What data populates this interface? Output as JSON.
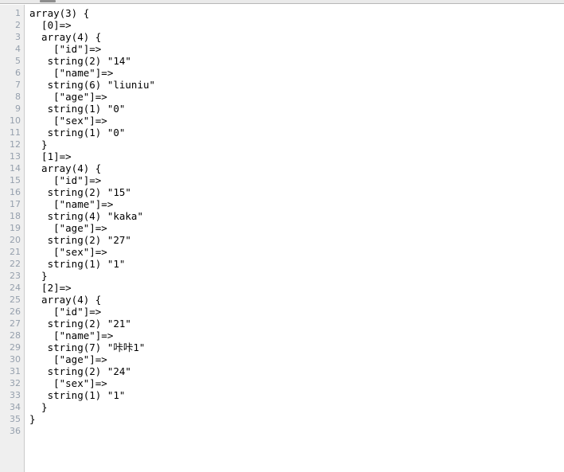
{
  "window": {
    "title": "var_dump output",
    "scrollbar": {
      "orientation": "horizontal",
      "thumb_label": "horizontal-scroll-thumb"
    }
  },
  "colors": {
    "background": "#ffffff",
    "gutter_background": "#efefef",
    "gutter_border": "#c9c9c9",
    "line_number_text": "#96a0ad",
    "code_text": "#000000",
    "chrome_strip": "#eaeaea",
    "chrome_border": "#b8b8b8",
    "scroll_thumb": "#8d8d8d"
  },
  "editor": {
    "total_lines": 36,
    "line_numbers": [
      1,
      2,
      3,
      4,
      5,
      6,
      7,
      8,
      9,
      10,
      11,
      12,
      13,
      14,
      15,
      16,
      17,
      18,
      19,
      20,
      21,
      22,
      23,
      24,
      25,
      26,
      27,
      28,
      29,
      30,
      31,
      32,
      33,
      34,
      35,
      36
    ],
    "lines": [
      "array(3) {",
      "  [0]=>",
      "  array(4) {",
      "    [\"id\"]=>",
      "   string(2) \"14\"",
      "    [\"name\"]=>",
      "   string(6) \"liuniu\"",
      "    [\"age\"]=>",
      "   string(1) \"0\"",
      "    [\"sex\"]=>",
      "   string(1) \"0\"",
      "  }",
      "  [1]=>",
      "  array(4) {",
      "    [\"id\"]=>",
      "   string(2) \"15\"",
      "    [\"name\"]=>",
      "   string(4) \"kaka\"",
      "    [\"age\"]=>",
      "   string(2) \"27\"",
      "    [\"sex\"]=>",
      "   string(1) \"1\"",
      "  }",
      "  [2]=>",
      "  array(4) {",
      "    [\"id\"]=>",
      "   string(2) \"21\"",
      "    [\"name\"]=>",
      "   string(7) \"咔咔1\"",
      "    [\"age\"]=>",
      "   string(2) \"24\"",
      "    [\"sex\"]=>",
      "   string(1) \"1\"",
      "  }",
      "}",
      ""
    ]
  },
  "dump_data": {
    "type": "php-var_dump",
    "root_type": "array",
    "root_count": 3,
    "records": [
      {
        "index": 0,
        "array_count": 4,
        "fields": [
          {
            "key": "id",
            "type": "string",
            "length": 2,
            "value": "14"
          },
          {
            "key": "name",
            "type": "string",
            "length": 6,
            "value": "liuniu"
          },
          {
            "key": "age",
            "type": "string",
            "length": 1,
            "value": "0"
          },
          {
            "key": "sex",
            "type": "string",
            "length": 1,
            "value": "0"
          }
        ]
      },
      {
        "index": 1,
        "array_count": 4,
        "fields": [
          {
            "key": "id",
            "type": "string",
            "length": 2,
            "value": "15"
          },
          {
            "key": "name",
            "type": "string",
            "length": 4,
            "value": "kaka"
          },
          {
            "key": "age",
            "type": "string",
            "length": 2,
            "value": "27"
          },
          {
            "key": "sex",
            "type": "string",
            "length": 1,
            "value": "1"
          }
        ]
      },
      {
        "index": 2,
        "array_count": 4,
        "fields": [
          {
            "key": "id",
            "type": "string",
            "length": 2,
            "value": "21"
          },
          {
            "key": "name",
            "type": "string",
            "length": 7,
            "value": "咔咔1"
          },
          {
            "key": "age",
            "type": "string",
            "length": 2,
            "value": "24"
          },
          {
            "key": "sex",
            "type": "string",
            "length": 1,
            "value": "1"
          }
        ]
      }
    ]
  }
}
